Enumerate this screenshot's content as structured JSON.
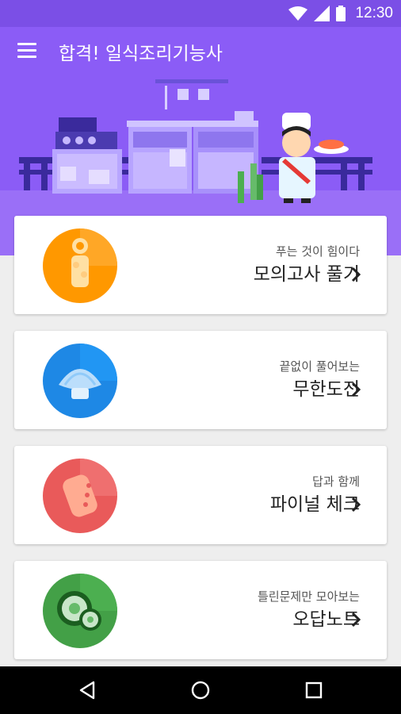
{
  "status_bar": {
    "time": "12:30"
  },
  "app_bar": {
    "title": "합격! 일식조리기능사"
  },
  "menu": [
    {
      "subtitle": "푸는 것이 힘이다",
      "title": "모의고사 풀기",
      "color": "#ff9800"
    },
    {
      "subtitle": "끝없이 풀어보는",
      "title": "무한도전",
      "color": "#1e88e5"
    },
    {
      "subtitle": "답과 함께",
      "title": "파이널 체크",
      "color": "#e95a5a"
    },
    {
      "subtitle": "틀린문제만 모아보는",
      "title": "오답노트",
      "color": "#43a047"
    }
  ],
  "nav": {
    "back": "back-icon",
    "home": "home-icon",
    "recents": "recents-icon"
  }
}
